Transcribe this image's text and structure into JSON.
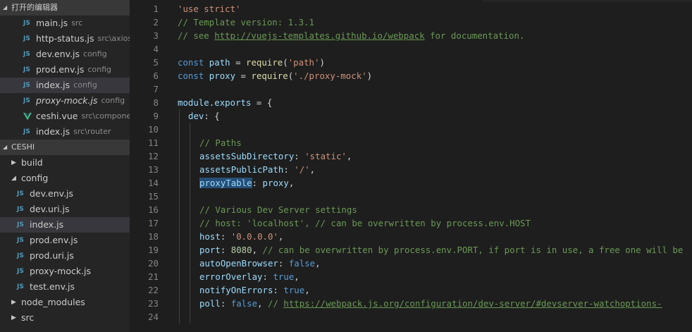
{
  "sidebar": {
    "open_editors": {
      "title": "打开的编辑器",
      "items": [
        {
          "icon": "js-file-icon",
          "name": "main.js",
          "desc": "src"
        },
        {
          "icon": "js-file-icon",
          "name": "http-status.js",
          "desc": "src\\axios"
        },
        {
          "icon": "js-file-icon",
          "name": "dev.env.js",
          "desc": "config"
        },
        {
          "icon": "js-file-icon",
          "name": "prod.env.js",
          "desc": "config"
        },
        {
          "icon": "js-file-icon",
          "name": "index.js",
          "desc": "config",
          "selected": true
        },
        {
          "icon": "js-file-icon",
          "name": "proxy-mock.js",
          "desc": "config",
          "italic": true
        },
        {
          "icon": "vue-file-icon",
          "name": "ceshi.vue",
          "desc": "src\\compone..."
        },
        {
          "icon": "js-file-icon",
          "name": "index.js",
          "desc": "src\\router"
        }
      ]
    },
    "project": {
      "title": "CESHI",
      "tree": [
        {
          "kind": "folder",
          "name": "build",
          "expanded": false,
          "depth": 0
        },
        {
          "kind": "folder",
          "name": "config",
          "expanded": true,
          "depth": 0
        },
        {
          "kind": "file",
          "name": "dev.env.js",
          "depth": 1
        },
        {
          "kind": "file",
          "name": "dev.uri.js",
          "depth": 1
        },
        {
          "kind": "file",
          "name": "index.js",
          "depth": 1,
          "selected": true
        },
        {
          "kind": "file",
          "name": "prod.env.js",
          "depth": 1
        },
        {
          "kind": "file",
          "name": "prod.uri.js",
          "depth": 1
        },
        {
          "kind": "file",
          "name": "proxy-mock.js",
          "depth": 1
        },
        {
          "kind": "file",
          "name": "test.env.js",
          "depth": 1
        },
        {
          "kind": "folder",
          "name": "node_modules",
          "expanded": false,
          "depth": 0
        },
        {
          "kind": "folder",
          "name": "src",
          "expanded": false,
          "depth": 0
        }
      ]
    }
  },
  "editor": {
    "lines": [
      {
        "n": "1",
        "indent": 0,
        "tokens": [
          [
            "str",
            "'use strict'"
          ]
        ]
      },
      {
        "n": "2",
        "indent": 0,
        "tokens": [
          [
            "com",
            "// Template version: 1.3.1"
          ]
        ]
      },
      {
        "n": "3",
        "indent": 0,
        "tokens": [
          [
            "com",
            "// see "
          ],
          [
            "url",
            "http://vuejs-templates.github.io/webpack"
          ],
          [
            "com",
            " for documentation."
          ]
        ]
      },
      {
        "n": "4",
        "indent": 0,
        "tokens": []
      },
      {
        "n": "5",
        "indent": 0,
        "tokens": [
          [
            "kw",
            "const"
          ],
          [
            "pl",
            " "
          ],
          [
            "id",
            "path"
          ],
          [
            "pl",
            " = "
          ],
          [
            "fn",
            "require"
          ],
          [
            "pl",
            "("
          ],
          [
            "str",
            "'path'"
          ],
          [
            "pl",
            ")"
          ]
        ]
      },
      {
        "n": "6",
        "indent": 0,
        "tokens": [
          [
            "kw",
            "const"
          ],
          [
            "pl",
            " "
          ],
          [
            "id",
            "proxy"
          ],
          [
            "pl",
            " = "
          ],
          [
            "fn",
            "require"
          ],
          [
            "pl",
            "("
          ],
          [
            "str",
            "'./proxy-mock'"
          ],
          [
            "pl",
            ")"
          ]
        ]
      },
      {
        "n": "7",
        "indent": 0,
        "tokens": []
      },
      {
        "n": "8",
        "indent": 0,
        "tokens": [
          [
            "id",
            "module"
          ],
          [
            "pl",
            "."
          ],
          [
            "id",
            "exports"
          ],
          [
            "pl",
            " = {"
          ]
        ]
      },
      {
        "n": "9",
        "indent": 1,
        "tokens": [
          [
            "id",
            "dev"
          ],
          [
            "pl",
            ": {"
          ]
        ]
      },
      {
        "n": "10",
        "indent": 2,
        "tokens": []
      },
      {
        "n": "11",
        "indent": 2,
        "tokens": [
          [
            "com",
            "// Paths"
          ]
        ]
      },
      {
        "n": "12",
        "indent": 2,
        "tokens": [
          [
            "id",
            "assetsSubDirectory"
          ],
          [
            "pl",
            ": "
          ],
          [
            "str",
            "'static'"
          ],
          [
            "pl",
            ","
          ]
        ]
      },
      {
        "n": "13",
        "indent": 2,
        "tokens": [
          [
            "id",
            "assetsPublicPath"
          ],
          [
            "pl",
            ": "
          ],
          [
            "str",
            "'/'"
          ],
          [
            "pl",
            ","
          ]
        ]
      },
      {
        "n": "14",
        "indent": 2,
        "tokens": [
          [
            "hl",
            "proxyTable"
          ],
          [
            "pl",
            ": "
          ],
          [
            "id",
            "proxy"
          ],
          [
            "pl",
            ","
          ]
        ]
      },
      {
        "n": "15",
        "indent": 2,
        "tokens": []
      },
      {
        "n": "16",
        "indent": 2,
        "tokens": [
          [
            "com",
            "// Various Dev Server settings"
          ]
        ]
      },
      {
        "n": "17",
        "indent": 2,
        "tokens": [
          [
            "com",
            "// host: 'localhost', // can be overwritten by process.env.HOST"
          ]
        ]
      },
      {
        "n": "18",
        "indent": 2,
        "tokens": [
          [
            "id",
            "host"
          ],
          [
            "pl",
            ": "
          ],
          [
            "str",
            "'0.0.0.0'"
          ],
          [
            "pl",
            ","
          ]
        ]
      },
      {
        "n": "19",
        "indent": 2,
        "tokens": [
          [
            "id",
            "port"
          ],
          [
            "pl",
            ": "
          ],
          [
            "num",
            "8080"
          ],
          [
            "pl",
            ", "
          ],
          [
            "com",
            "// can be overwritten by process.env.PORT, if port is in use, a free one will be"
          ]
        ]
      },
      {
        "n": "20",
        "indent": 2,
        "tokens": [
          [
            "id",
            "autoOpenBrowser"
          ],
          [
            "pl",
            ": "
          ],
          [
            "bool",
            "false"
          ],
          [
            "pl",
            ","
          ]
        ]
      },
      {
        "n": "21",
        "indent": 2,
        "tokens": [
          [
            "id",
            "errorOverlay"
          ],
          [
            "pl",
            ": "
          ],
          [
            "bool",
            "true"
          ],
          [
            "pl",
            ","
          ]
        ]
      },
      {
        "n": "22",
        "indent": 2,
        "tokens": [
          [
            "id",
            "notifyOnErrors"
          ],
          [
            "pl",
            ": "
          ],
          [
            "bool",
            "true"
          ],
          [
            "pl",
            ","
          ]
        ]
      },
      {
        "n": "23",
        "indent": 2,
        "tokens": [
          [
            "id",
            "poll"
          ],
          [
            "pl",
            ": "
          ],
          [
            "bool",
            "false"
          ],
          [
            "pl",
            ", "
          ],
          [
            "com",
            "// "
          ],
          [
            "url",
            "https://webpack.js.org/configuration/dev-server/#devserver-watchoptions-"
          ]
        ]
      },
      {
        "n": "24",
        "indent": 2,
        "tokens": []
      }
    ]
  },
  "colors": {
    "string": "#ce9178",
    "comment": "#6a9955",
    "keyword": "#569cd6",
    "identifier": "#9cdcfe",
    "function": "#dcdcaa",
    "number": "#b5cea8",
    "selection": "#264f78",
    "js_icon": "#519aba",
    "vue_icon": "#41b883"
  }
}
